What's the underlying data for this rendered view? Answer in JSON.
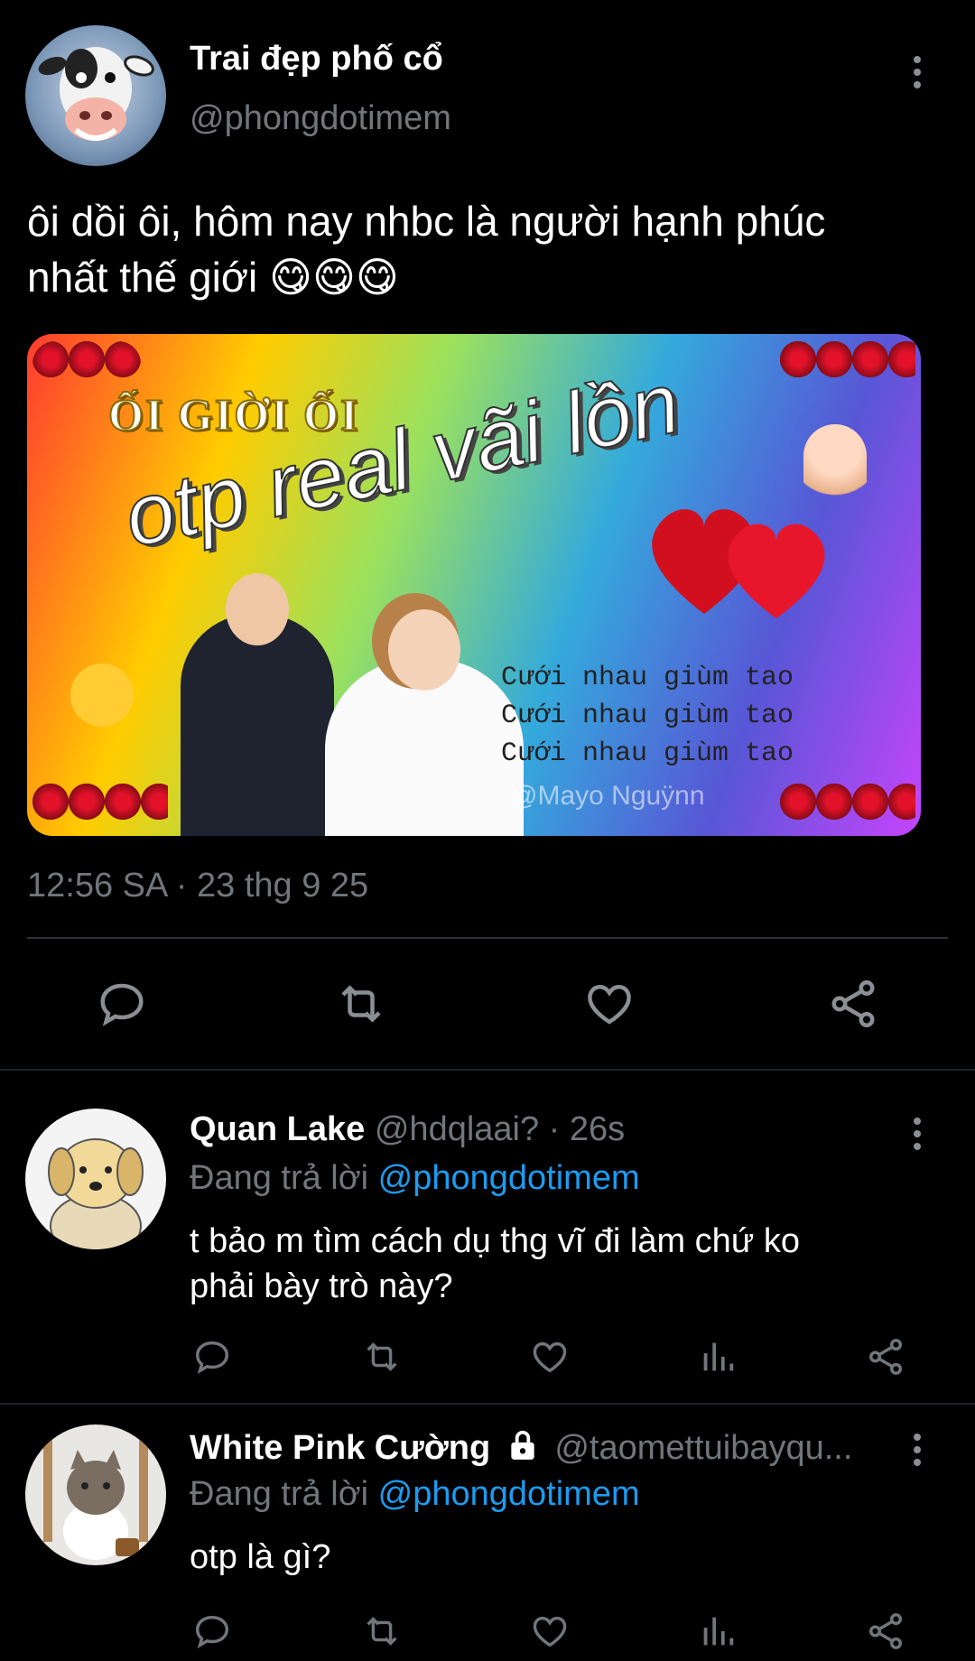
{
  "main_tweet": {
    "display_name": "Trai đẹp phố cổ",
    "handle": "@phongdotimem",
    "text_line1": "ôi dồi ôi, hôm nay nhbc là người hạnh phúc",
    "text_line2": "nhất thế giới",
    "emojis": "😋😋😋",
    "timestamp": "12:56 SA · 23 thg 9 25",
    "avatar_icon": "cow-face-avatar",
    "media": {
      "top_text": "ỐI GIỜI ỐI",
      "headline": "otp real vãi lồn",
      "lines": [
        "Cưới nhau giùm tao",
        "Cưới nhau giùm tao",
        "Cưới nhau giùm tao"
      ],
      "watermark": "@Mayo Nguÿnn",
      "colors": {
        "gradient": [
          "#ff3b30",
          "#ffcc00",
          "#4cd964",
          "#34aadc",
          "#5856d6",
          "#c644fc"
        ]
      }
    }
  },
  "replies": [
    {
      "display_name": "Quan Lake",
      "handle_time": "@hdqlaai? · 26s",
      "replying_label": "Đang trả lời",
      "replying_to": "@phongdotimem",
      "text_line1": "t bảo m tìm cách dụ thg vĩ đi làm chứ ko",
      "text_line2": "phải bày trò này?",
      "avatar_icon": "dog-avatar",
      "locked": false
    },
    {
      "display_name": "White Pink Cường",
      "handle_time": "@taomettuibayqu...",
      "replying_label": "Đang trả lời",
      "replying_to": "@phongdotimem",
      "text_line1": "otp là gì?",
      "text_line2": "",
      "avatar_icon": "cat-avatar",
      "locked": true
    }
  ],
  "colors": {
    "background": "#000000",
    "accent": "#1d9bf0",
    "muted": "#71767b"
  }
}
